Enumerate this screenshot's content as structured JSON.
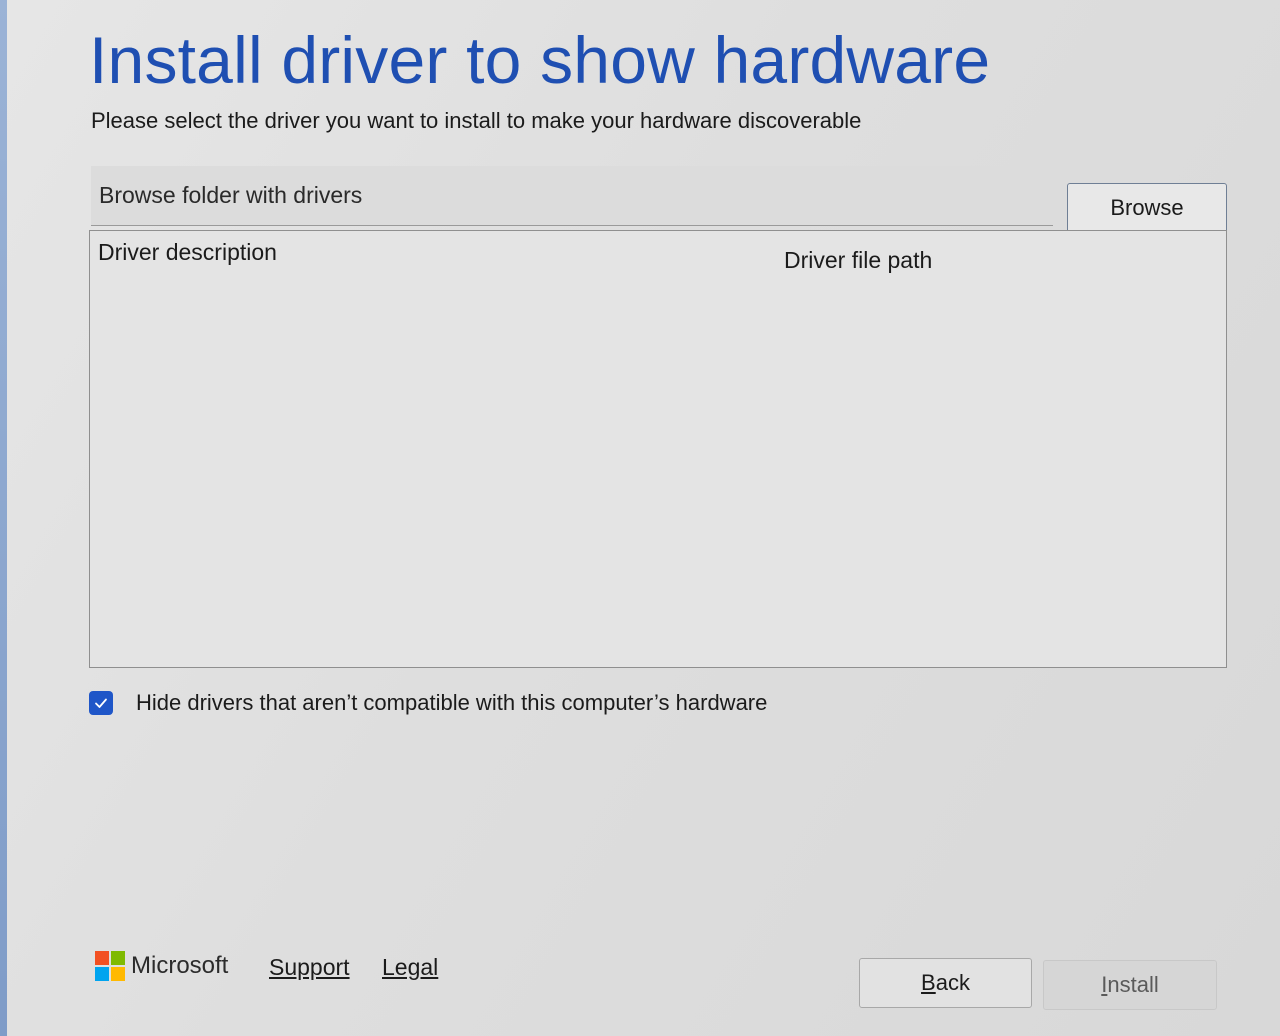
{
  "header": {
    "title": "Install driver to show hardware",
    "subtitle": "Please select the driver you want to install to make your hardware discoverable"
  },
  "folder": {
    "placeholder": "Browse folder with drivers",
    "value": "",
    "browse_label": "Browse"
  },
  "table": {
    "columns": [
      "Driver description",
      "Driver file path"
    ],
    "rows": []
  },
  "filter": {
    "checked": true,
    "label": "Hide drivers that aren’t compatible with this computer’s hardware"
  },
  "footer": {
    "brand": "Microsoft",
    "links": [
      "Support",
      "Legal"
    ],
    "back_mnemonic": "B",
    "back_rest": "ack",
    "install_mnemonic": "I",
    "install_rest": "nstall",
    "install_enabled": false
  },
  "colors": {
    "title": "#1f4fb2",
    "checkbox": "#1f56c8",
    "ms_red": "#f25022",
    "ms_green": "#7fba00",
    "ms_blue": "#00a4ef",
    "ms_yellow": "#ffb900"
  },
  "icons": {
    "checkbox": "checkmark-icon",
    "brand": "microsoft-logo-icon"
  }
}
